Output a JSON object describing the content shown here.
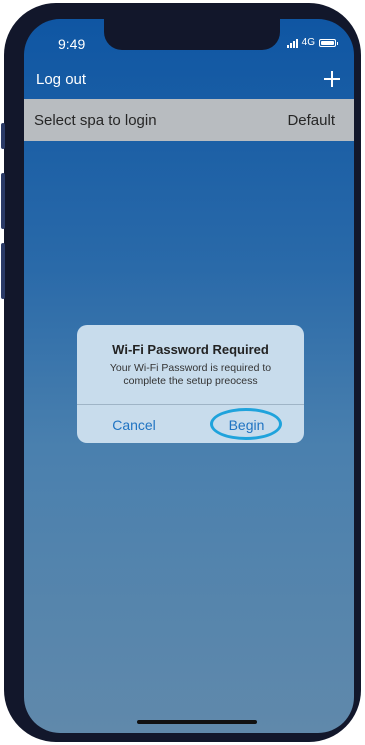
{
  "status_bar": {
    "time": "9:49",
    "network": "4G"
  },
  "nav": {
    "logout_label": "Log out",
    "add_icon": "plus-icon"
  },
  "spa_row": {
    "label": "Select spa to login",
    "value": "Default"
  },
  "dialog": {
    "title": "Wi-Fi Password Required",
    "message": "Your Wi-Fi Password is required to\ncomplete the setup preocess",
    "cancel_label": "Cancel",
    "begin_label": "Begin"
  },
  "colors": {
    "accent": "#1f73c2",
    "highlight": "#1fa3dc",
    "nav_bg": "#0f56a3"
  }
}
